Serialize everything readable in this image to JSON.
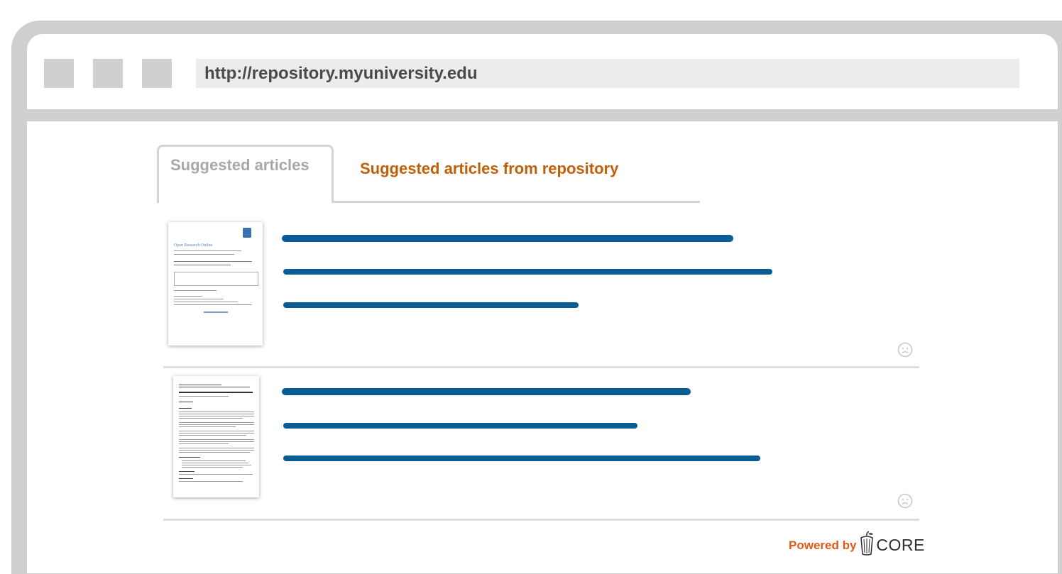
{
  "browser": {
    "url": "http://repository.myuniversity.edu"
  },
  "tabs": [
    {
      "label": "Suggested articles",
      "active": true
    },
    {
      "label": "Suggested articles from repository",
      "active": false
    }
  ],
  "articles": [
    {
      "thumbnail": {
        "header": "Open Research Online",
        "subheader": "The Open University's repository of research publications and other research outputs",
        "title": "Integration of the IRUS-UK Statistics in the CORE Repositories Dashboard",
        "footer": "oro.open.ac.uk"
      },
      "feedback_icon": "sad-face-icon"
    },
    {
      "thumbnail": {
        "title": "OpenAIRE infrastructure and services: advancing Open Science"
      },
      "feedback_icon": "sad-face-icon"
    }
  ],
  "footer": {
    "powered_label": "Powered by",
    "brand": "CORE"
  },
  "colors": {
    "accent_orange": "#c0600a",
    "bar_blue": "#0b5b95",
    "powered_orange": "#e2571c"
  }
}
